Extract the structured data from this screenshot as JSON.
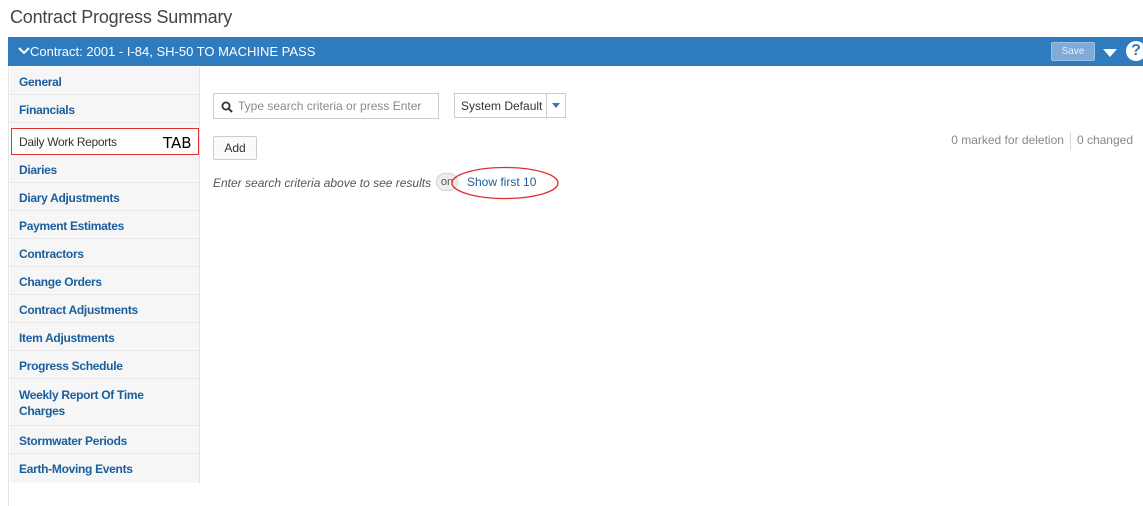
{
  "page": {
    "title": "Contract Progress Summary"
  },
  "header": {
    "contract_title": "Contract: 2001 - I-84, SH-50 TO MACHINE PASS",
    "save_label": "Save",
    "help_label": "?"
  },
  "sidebar": {
    "items": [
      {
        "label": "General"
      },
      {
        "label": "Financials"
      },
      {
        "label": "Daily Work Reports"
      },
      {
        "label": "Diaries"
      },
      {
        "label": "Diary Adjustments"
      },
      {
        "label": "Payment Estimates"
      },
      {
        "label": "Contractors"
      },
      {
        "label": "Change Orders"
      },
      {
        "label": "Contract Adjustments"
      },
      {
        "label": "Item Adjustments"
      },
      {
        "label": "Progress Schedule"
      },
      {
        "label": "Weekly Report Of Time Charges"
      },
      {
        "label": "Stormwater Periods"
      },
      {
        "label": "Earth-Moving Events"
      }
    ],
    "active_index": 2
  },
  "annotation": {
    "tab_label": "TAB"
  },
  "search": {
    "placeholder": "Type search criteria or press Enter",
    "value": ""
  },
  "layout_select": {
    "value": "System Default"
  },
  "toolbar": {
    "add_label": "Add"
  },
  "status": {
    "marked_for_deletion": "0 marked for deletion",
    "changed": "0 changed"
  },
  "results": {
    "hint": "Enter search criteria above to see results",
    "toggle_label": "on",
    "show_first_label": "Show first 10"
  },
  "colors": {
    "header_bar": "#2e7bbf",
    "link": "#1a5e9e",
    "annotation_red": "#e0302e"
  }
}
